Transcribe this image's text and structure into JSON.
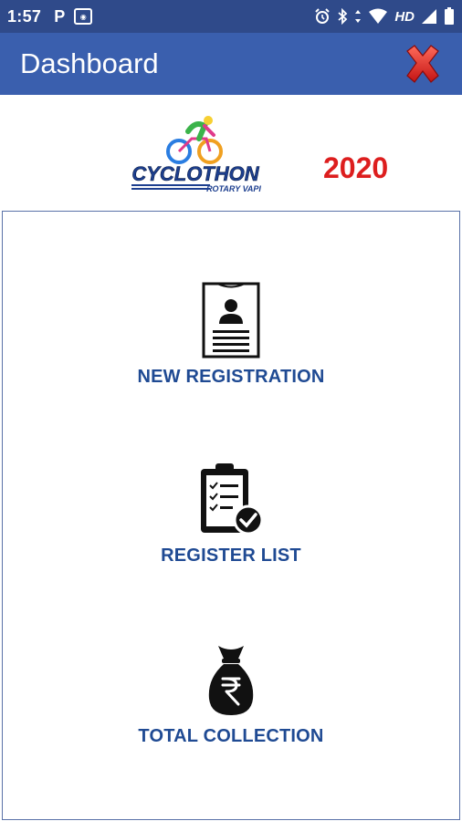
{
  "status_bar": {
    "time": "1:57",
    "left_icons": [
      "parking-app-icon",
      "image-app-icon"
    ],
    "right_icons": [
      "alarm-icon",
      "bluetooth-icon",
      "data-arrows-icon",
      "wifi-icon",
      "hd-label",
      "signal-icon",
      "battery-icon"
    ],
    "hd": "HD"
  },
  "app_bar": {
    "title": "Dashboard",
    "close_icon": "close-icon",
    "bg_color": "#3a5fae"
  },
  "header": {
    "logo_text": "CYCLOTHON",
    "logo_subtext": "ROTARY VAPI",
    "year": "2020",
    "year_color": "#dd1e1e"
  },
  "menu": {
    "items": [
      {
        "label": "NEW REGISTRATION",
        "icon": "registration-form-icon"
      },
      {
        "label": "REGISTER LIST",
        "icon": "clipboard-checklist-icon"
      },
      {
        "label": "TOTAL COLLECTION",
        "icon": "money-bag-icon"
      }
    ],
    "label_color": "#1f4a93"
  }
}
